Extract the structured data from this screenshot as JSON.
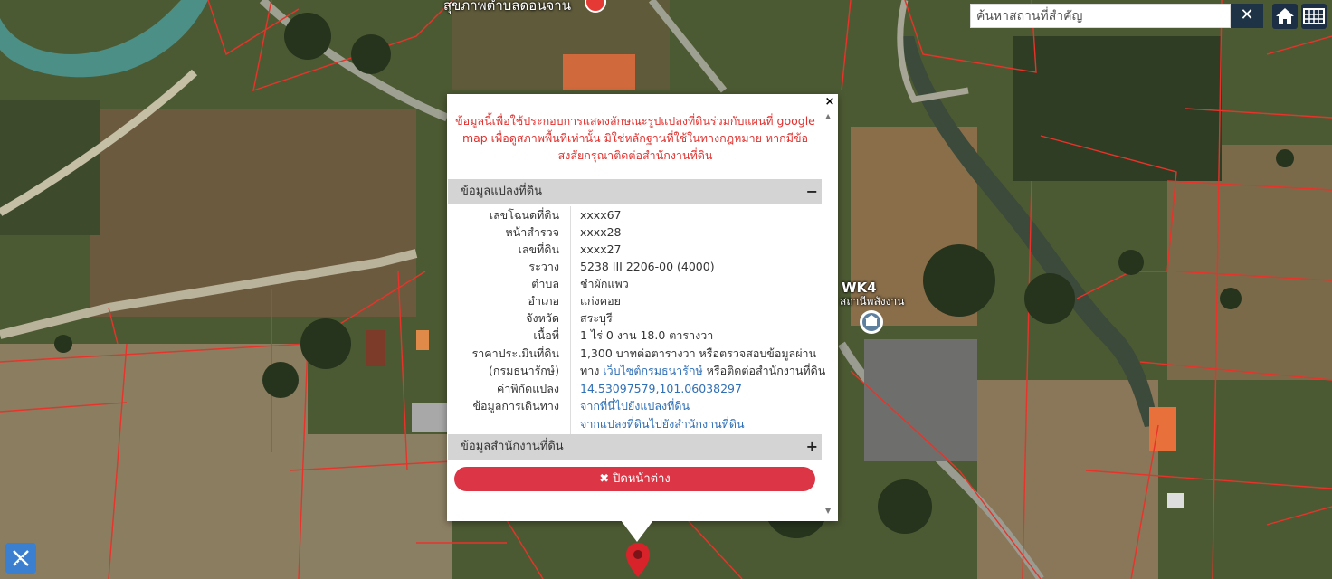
{
  "search": {
    "placeholder": "ค้นหาสถานที่สำคัญ",
    "clear_glyph": "✕"
  },
  "map_labels": {
    "top": "สุขภาพตำบลดอนจาน",
    "wk4": "WK4",
    "station": "สถานีพลังงาน"
  },
  "popup": {
    "close_glyph": "×",
    "disclaimer": "ข้อมูลนี้เพื่อใช้ประกอบการแสดงลักษณะรูปแปลงที่ดินร่วมกับแผนที่ google map เพื่อดูสภาพพื้นที่เท่านั้น มิใช่หลักฐานที่ใช้ในทางกฎหมาย หากมีข้อสงสัยกรุณาติดต่อสำนักงานที่ดิน",
    "section1": {
      "title": "ข้อมูลแปลงที่ดิน",
      "toggle": "−"
    },
    "rows": [
      {
        "key": "เลขโฉนดที่ดิน",
        "value": "xxxx67"
      },
      {
        "key": "หน้าสำรวจ",
        "value": "xxxx28"
      },
      {
        "key": "เลขที่ดิน",
        "value": "xxxx27"
      },
      {
        "key": "ระวาง",
        "value": "5238 III 2206-00 (4000)"
      },
      {
        "key": "ตำบล",
        "value": "ชำผักแพว"
      },
      {
        "key": "อำเภอ",
        "value": "แก่งคอย"
      },
      {
        "key": "จังหวัด",
        "value": "สระบุรี"
      },
      {
        "key": "เนื้อที่",
        "value": "1 ไร่ 0 งาน 18.0 ตารางวา"
      }
    ],
    "price": {
      "key1": "ราคาประเมินที่ดิน",
      "key2": "(กรมธนารักษ์)",
      "line1": "1,300 บาทต่อตารางวา หรือตรวจสอบข้อมูลผ่าน",
      "line2_pre": "ทาง ",
      "line2_link": "เว็บไซต์กรมธนารักษ์",
      "line2_post": " หรือติดต่อสำนักงานที่ดิน"
    },
    "coords": {
      "key": "ค่าพิกัดแปลง",
      "value": "14.53097579,101.06038297"
    },
    "travel": {
      "key": "ข้อมูลการเดินทาง",
      "link1": "จากที่นี่ไปยังแปลงที่ดิน",
      "link2": "จากแปลงที่ดินไปยังสำนักงานที่ดิน"
    },
    "section2": {
      "title": "ข้อมูลสำนักงานที่ดิน",
      "toggle": "+"
    },
    "close_button": {
      "icon": "✖",
      "label": "ปิดหน้าต่าง"
    }
  },
  "colors": {
    "parcel_line": "#e8332a",
    "close_button": "#dc3545",
    "link": "#2f6fb5",
    "disclaimer": "#e0322f"
  }
}
